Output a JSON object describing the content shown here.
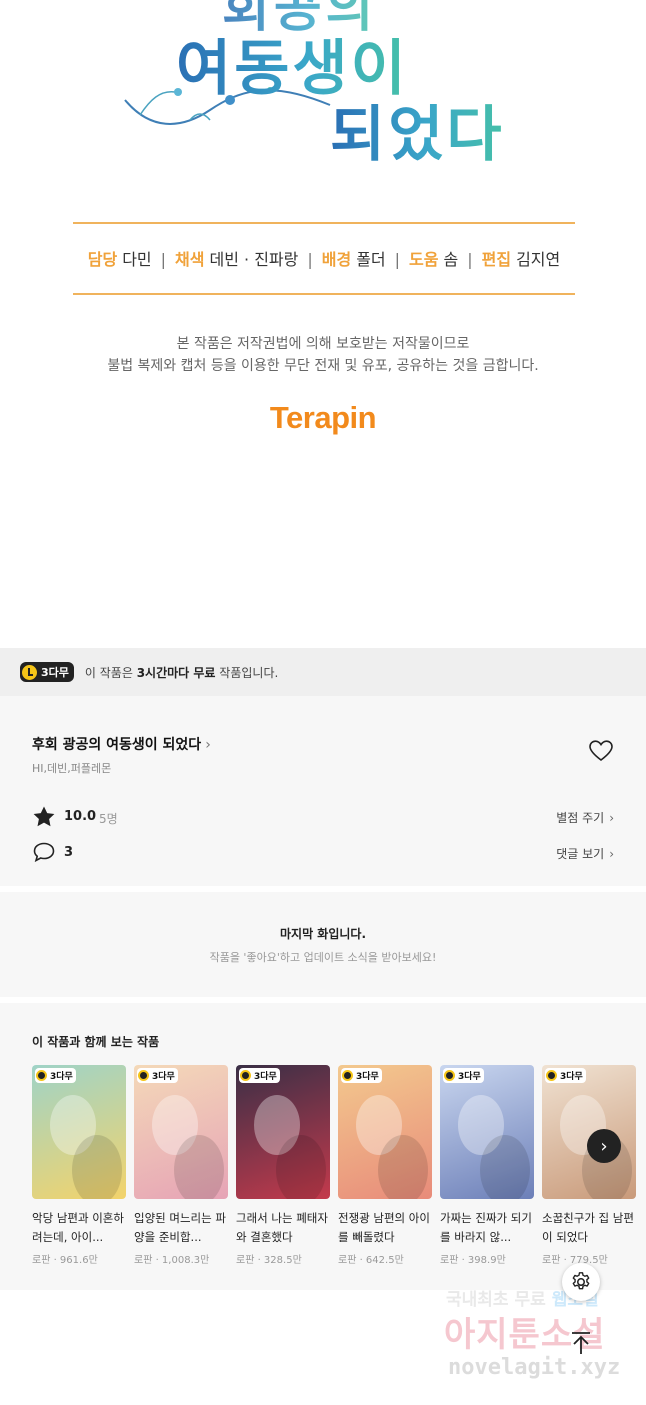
{
  "title_art": {
    "line1": "회공의",
    "line2": "여동생이",
    "line3": "되었다"
  },
  "credits": [
    {
      "role": "담당",
      "name": "다민"
    },
    {
      "role": "채색",
      "name": "데빈 · 진파랑"
    },
    {
      "role": "배경",
      "name": "폴더"
    },
    {
      "role": "도움",
      "name": "솜"
    },
    {
      "role": "편집",
      "name": "김지연"
    }
  ],
  "copyright": {
    "line1": "본 작품은 저작권법에 의해 보호받는 저작물이므로",
    "line2": "불법 복제와 캡처 등을 이용한 무단 전재 및 유포, 공유하는 것을 금합니다."
  },
  "brand_logo": "Terapin",
  "free_banner": {
    "badge": "3다무",
    "text_prefix": "이 작품은 ",
    "text_bold": "3시간마다 무료",
    "text_suffix": " 작품입니다."
  },
  "series": {
    "title": "후회 광공의 여동생이 되었다",
    "authors": "HI,데빈,퍼플레몬",
    "rating": "10.0",
    "rating_count": "5명",
    "rating_link": "별점 주기",
    "comment_count": "3",
    "comment_link": "댓글 보기"
  },
  "last_episode": {
    "title": "마지막 화입니다.",
    "subtitle": "작품을 '좋아요'하고 업데이트 소식을 받아보세요!"
  },
  "recommendations": {
    "heading": "이 작품과 함께 보는 작품",
    "badge": "3다무",
    "items": [
      {
        "name": "악당 남편과 이혼하려는데, 아이...",
        "meta": "로판 · 961.6만",
        "bg": "#9fd3c7",
        "accent": "#f3d36b"
      },
      {
        "name": "입양된 며느리는 파양을 준비합...",
        "meta": "로판 · 1,008.3만",
        "bg": "#f4d9b8",
        "accent": "#e6a3b6"
      },
      {
        "name": "그래서 나는 폐태자와 결혼했다",
        "meta": "로판 · 328.5만",
        "bg": "#3a2f46",
        "accent": "#c43a4c"
      },
      {
        "name": "전쟁광 남편의 아이를 빼돌렸다",
        "meta": "로판 · 642.5만",
        "bg": "#f3c98e",
        "accent": "#e88b7a"
      },
      {
        "name": "가짜는 진짜가 되기를 바라지 않...",
        "meta": "로판 · 398.9만",
        "bg": "#c9d6ef",
        "accent": "#6c7fb8"
      },
      {
        "name": "소꿉친구가 집 남편이 되었다",
        "meta": "로판 · 779.5만",
        "bg": "#f0e2d2",
        "accent": "#c99a7a"
      }
    ]
  },
  "watermark": {
    "line1_a": "국내최초 무료 ",
    "line1_b": "웹소설",
    "line2": "아지툰소설",
    "line3": "novelagit.xyz"
  },
  "colors": {
    "accent_orange": "#f0a23a",
    "brand_orange": "#f28a1c",
    "badge_yellow": "#f5c518"
  }
}
